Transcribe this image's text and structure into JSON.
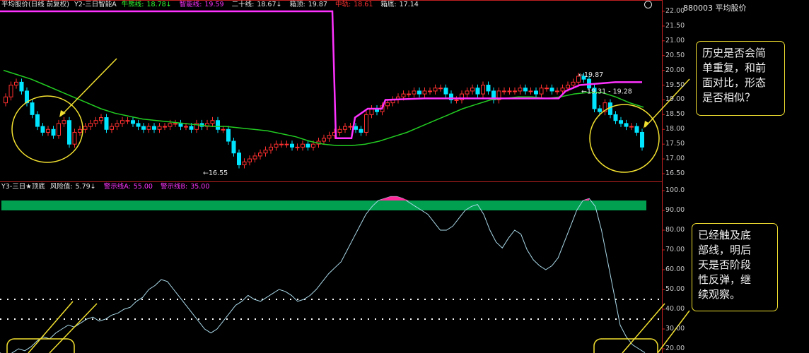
{
  "top_panel": {
    "title": "平均股价(日线 前复权)",
    "indicator": "Y2-三日智能A",
    "bull_line_label": "牛熊线:",
    "bull_line_value": "18.78↓",
    "smart_line_label": "智能线:",
    "smart_line_value": "19.59",
    "twenty_line_label": "二十线:",
    "twenty_line_value": "18.67↓",
    "box_top_label": "箱顶:",
    "box_top_value": "19.87",
    "middle_track_label": "中轨:",
    "middle_track_value": "18.61",
    "box_bottom_label": "箱底:",
    "box_bottom_value": "17.14",
    "price_ticks": [
      "22.00",
      "21.50",
      "21.00",
      "20.50",
      "20.00",
      "19.50",
      "19.00",
      "18.50",
      "18.00",
      "17.50",
      "17.00",
      "16.50"
    ],
    "annotations": [
      "19.87",
      "19.31 - 19.28",
      "16.55"
    ]
  },
  "bottom_panel": {
    "title": "Y3-三日★顶底",
    "risk_label": "风险值:",
    "risk_value": "5.79↓",
    "warn_a_label": "警示线A:",
    "warn_a_value": "55.00",
    "warn_b_label": "警示线B:",
    "warn_b_value": "35.00",
    "ticks": [
      "100.0",
      "90.00",
      "80.00",
      "70.00",
      "60.00",
      "50.00",
      "40.00",
      "30.00",
      "20.00"
    ]
  },
  "security_code": "880003 平均股价",
  "notes": {
    "note1": [
      "历史是否会简",
      "单重复，和前",
      "面对比，形态",
      "是否相似？"
    ],
    "note2": [
      "已经触及底",
      "部线，明后",
      "天是否阶段",
      "性反弹，继",
      "续观察。"
    ]
  },
  "colors": {
    "background": "#000000",
    "up_candle": "#ff3030",
    "down_candle": "#00e5ff",
    "ma_line": "#22cc22",
    "smart_line": "#ff33ff",
    "indicator_line": "#a9d8e8",
    "green_band": "#00a050",
    "highlight": "#ff2a9a",
    "annotation": "#f2e030"
  },
  "chart_data": {
    "type": "candlestick+line",
    "price_ylim": [
      16.4,
      22.1
    ],
    "closes": [
      19.1,
      19.5,
      19.6,
      19.3,
      18.9,
      18.5,
      18.1,
      17.9,
      18.0,
      17.8,
      18.2,
      18.3,
      17.5,
      17.9,
      18.0,
      18.1,
      18.2,
      18.3,
      18.4,
      18.0,
      18.1,
      18.2,
      18.3,
      18.3,
      18.2,
      18.1,
      18.0,
      18.1,
      18.0,
      18.1,
      18.1,
      18.2,
      18.2,
      18.1,
      18.1,
      18.0,
      18.2,
      18.1,
      18.2,
      18.3,
      18.0,
      18.0,
      17.6,
      17.2,
      16.8,
      16.9,
      17.0,
      17.1,
      17.2,
      17.3,
      17.4,
      17.5,
      17.5,
      17.5,
      17.4,
      17.4,
      17.5,
      17.4,
      17.5,
      17.6,
      17.7,
      17.8,
      17.9,
      18.0,
      18.1,
      18.1,
      18.0,
      17.9,
      18.5,
      18.7,
      18.6,
      18.8,
      18.9,
      19.0,
      19.1,
      19.2,
      19.2,
      19.3,
      19.2,
      19.3,
      19.3,
      19.4,
      19.4,
      19.2,
      19.0,
      19.0,
      19.2,
      19.3,
      19.4,
      19.2,
      19.5,
      19.3,
      19.0,
      19.3,
      19.3,
      19.3,
      19.3,
      19.4,
      19.3,
      19.3,
      19.2,
      19.4,
      19.4,
      19.3,
      19.3,
      19.4,
      19.5,
      19.6,
      19.8,
      19.7,
      19.4,
      18.7,
      18.6,
      18.9,
      18.5,
      18.3,
      18.2,
      18.1,
      18.1,
      17.9,
      17.4
    ],
    "ma_line": [
      20.0,
      19.85,
      19.7,
      19.5,
      19.3,
      19.1,
      18.9,
      18.7,
      18.55,
      18.45,
      18.35,
      18.3,
      18.25,
      18.2,
      18.15,
      18.1,
      18.1,
      18.05,
      18.0,
      17.95,
      17.85,
      17.75,
      17.6,
      17.5,
      17.45,
      17.45,
      17.5,
      17.6,
      17.75,
      17.9,
      18.1,
      18.3,
      18.5,
      18.7,
      18.85,
      19.0,
      19.05,
      19.1,
      19.1,
      19.05,
      19.1,
      19.2,
      19.25,
      19.25,
      19.1,
      18.9,
      18.75
    ],
    "smart_line": [
      22.0,
      22.0,
      17.7,
      17.7,
      18.4,
      18.7,
      18.7,
      19.0,
      19.05,
      19.05,
      19.05,
      19.05,
      19.05,
      19.05,
      19.3,
      19.5,
      19.6,
      19.6
    ],
    "indicator_ylim": [
      15,
      105
    ],
    "indicator": [
      18,
      16,
      18,
      20,
      19,
      21,
      24,
      26,
      25,
      28,
      30,
      32,
      31,
      33,
      35,
      36,
      34,
      35,
      37,
      38,
      40,
      41,
      44,
      46,
      50,
      52,
      55,
      54,
      50,
      46,
      42,
      38,
      34,
      30,
      28,
      30,
      34,
      38,
      42,
      44,
      47,
      45,
      44,
      46,
      48,
      50,
      49,
      47,
      44,
      45,
      47,
      50,
      54,
      58,
      61,
      64,
      70,
      76,
      82,
      88,
      92,
      95,
      96,
      97,
      97,
      96,
      94,
      92,
      90,
      88,
      84,
      80,
      80,
      82,
      86,
      90,
      92,
      93,
      88,
      80,
      74,
      71,
      76,
      80,
      78,
      70,
      65,
      62,
      60,
      62,
      66,
      74,
      82,
      90,
      95,
      96,
      92,
      80,
      64,
      48,
      32,
      26,
      22,
      20,
      18
    ]
  }
}
